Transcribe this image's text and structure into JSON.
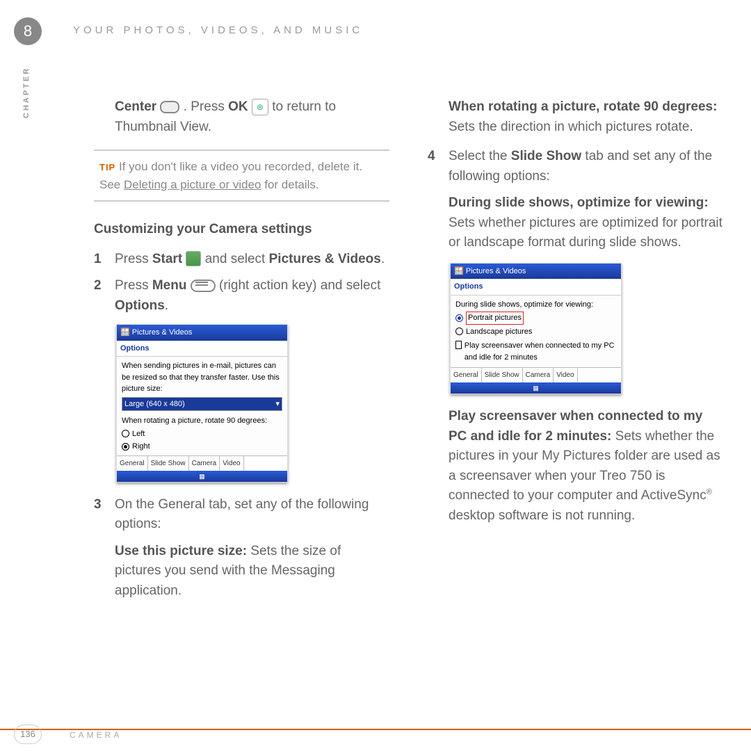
{
  "chapter_number": "8",
  "running_head": "YOUR PHOTOS, VIDEOS, AND MUSIC",
  "chapter_label": "CHAPTER",
  "left": {
    "intro_part1": "Center ",
    "intro_part2": ". Press ",
    "intro_bold_ok": "OK",
    "intro_part3": " to return to Thumbnail View.",
    "tip_label": "TIP",
    "tip_text_a": " If you don't like a video you recorded, delete it. See ",
    "tip_link": "Deleting a picture or video",
    "tip_text_b": " for details.",
    "section_head": "Customizing your Camera settings",
    "step1_a": "Press ",
    "step1_b": "Start",
    "step1_c": " and select ",
    "step1_d": "Pictures & Videos",
    "step1_e": ".",
    "step2_a": "Press ",
    "step2_b": "Menu",
    "step2_c": " (right action key) and select ",
    "step2_d": "Options",
    "step2_e": ".",
    "step3": "On the General tab, set any of the following options:",
    "use_size_head": "Use this picture size:",
    "use_size_body": " Sets the size of pictures you send with the Messaging application."
  },
  "right": {
    "rotate_head": "When rotating a picture, rotate 90 degrees:",
    "rotate_body": " Sets the direction in which pictures rotate.",
    "step4_a": "Select the ",
    "step4_b": "Slide Show",
    "step4_c": " tab and set any of the following options:",
    "during_head": "During slide shows, optimize for viewing:",
    "during_body": " Sets whether pictures are optimized for portrait or landscape format during slide shows.",
    "screensaver_head": "Play screensaver when connected to my PC and idle for 2 minutes:",
    "screensaver_body_a": " Sets whether the pictures in your My Pictures folder are used as a screensaver when your Treo 750 is connected to your computer and ActiveSync",
    "screensaver_reg": "®",
    "screensaver_body_b": " desktop software is not running."
  },
  "shot1": {
    "title": "Pictures & Videos",
    "options": "Options",
    "line1": "When sending pictures in e-mail, pictures can be resized so that they transfer faster. Use this picture size:",
    "select": "Large (640 x 480)",
    "line2": "When rotating a picture, rotate 90 degrees:",
    "radio_left": "Left",
    "radio_right": "Right",
    "tabs": [
      "General",
      "Slide Show",
      "Camera",
      "Video"
    ]
  },
  "shot2": {
    "title": "Pictures & Videos",
    "options": "Options",
    "line1": "During slide shows, optimize for viewing:",
    "radio_portrait": "Portrait pictures",
    "radio_landscape": "Landscape pictures",
    "check": "Play screensaver when connected to my PC and idle for 2 minutes",
    "tabs": [
      "General",
      "Slide Show",
      "Camera",
      "Video"
    ]
  },
  "footer": {
    "page": "136",
    "text": "CAMERA"
  }
}
